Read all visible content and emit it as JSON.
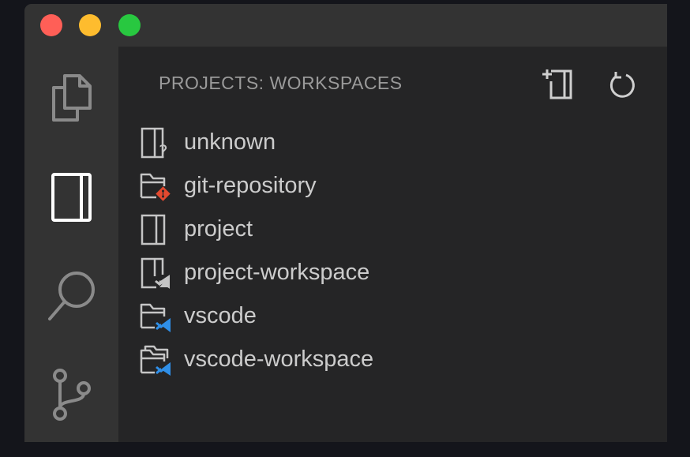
{
  "sidebar": {
    "header": "PROJECTS: WORKSPACES",
    "actions": [
      {
        "icon": "new-project-icon"
      },
      {
        "icon": "refresh-icon"
      }
    ],
    "items": [
      {
        "label": "unknown",
        "icon": "unknown-project-icon"
      },
      {
        "label": "git-repository",
        "icon": "git-folder-icon"
      },
      {
        "label": "project",
        "icon": "project-icon"
      },
      {
        "label": "project-workspace",
        "icon": "project-workspace-icon"
      },
      {
        "label": "vscode",
        "icon": "vscode-folder-icon"
      },
      {
        "label": "vscode-workspace",
        "icon": "vscode-workspace-icon"
      }
    ]
  },
  "activitybar": {
    "items": [
      {
        "icon": "explorer-icon"
      },
      {
        "icon": "projects-icon"
      },
      {
        "icon": "search-icon"
      },
      {
        "icon": "source-control-icon"
      }
    ]
  },
  "colors": {
    "git_accent": "#e2492f",
    "vscode_accent": "#2f8fe8",
    "icon_gray": "#c5c5c5"
  }
}
